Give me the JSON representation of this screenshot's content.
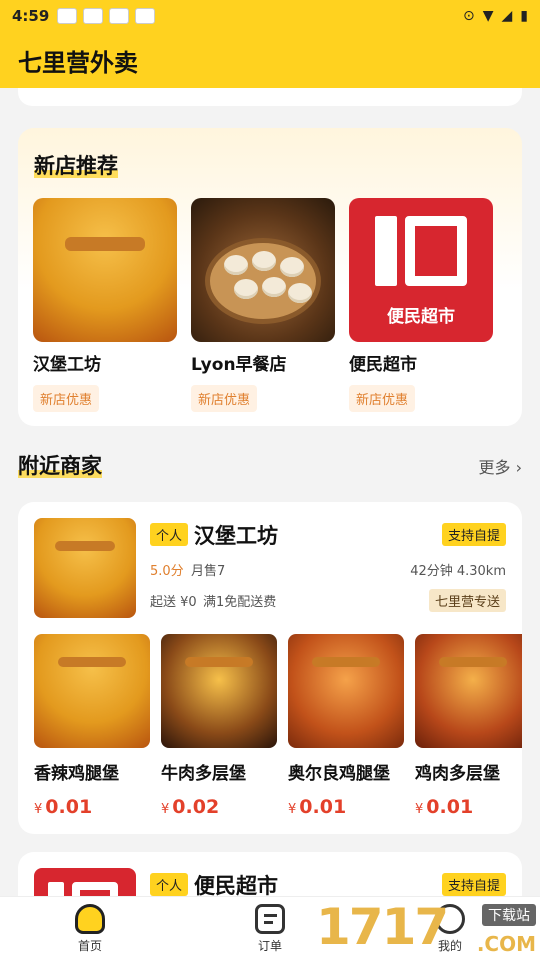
{
  "status_bar": {
    "time": "4:59"
  },
  "app": {
    "title": "七里营外卖"
  },
  "new_shops": {
    "title": "新店推荐",
    "items": [
      {
        "name": "汉堡工坊",
        "tag": "新店优惠",
        "image": "burger-image"
      },
      {
        "name": "Lyon早餐店",
        "tag": "新店优惠",
        "image": "dumpling-image"
      },
      {
        "name": "便民超市",
        "tag": "新店优惠",
        "image": "market-logo-image",
        "logo_text": "便民超市"
      }
    ]
  },
  "nearby": {
    "title": "附近商家",
    "more_label": "更多 ›",
    "merchants": [
      {
        "badge": "个人",
        "name": "汉堡工坊",
        "pickup": "支持自提",
        "rating": "5.0分",
        "sales": "月售7",
        "time_distance": "42分钟  4.30km",
        "min_price": "起送 ¥0",
        "free_ship": "满1免配送费",
        "delivery": "七里营专送",
        "products": [
          {
            "name": "香辣鸡腿堡",
            "currency": "¥",
            "price": "0.01"
          },
          {
            "name": "牛肉多层堡",
            "currency": "¥",
            "price": "0.02"
          },
          {
            "name": "奥尔良鸡腿堡",
            "currency": "¥",
            "price": "0.01"
          },
          {
            "name": "鸡肉多层堡",
            "currency": "¥",
            "price": "0.01"
          }
        ]
      },
      {
        "badge": "个人",
        "name": "便民超市",
        "pickup": "支持自提"
      }
    ]
  },
  "tabbar": {
    "home": "首页",
    "orders": "订单",
    "me": "我的"
  },
  "watermark": {
    "number": "1717",
    "download": "下载站",
    "domain": ".COM"
  },
  "colors": {
    "accent": "#ffd21f",
    "price": "#e3402a",
    "rating": "#e0802f"
  }
}
